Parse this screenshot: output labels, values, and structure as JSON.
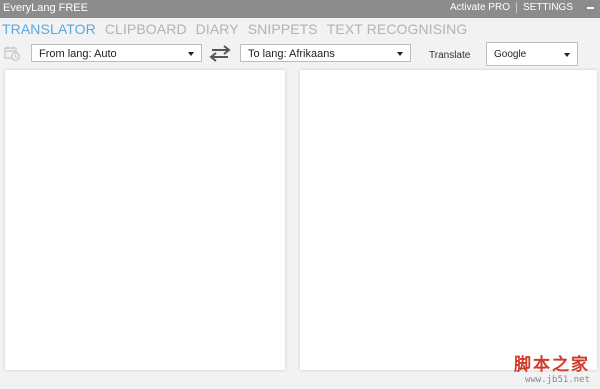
{
  "window": {
    "title": "EveryLang FREE",
    "activate_label": "Activate PRO",
    "settings_label": "SETTINGS"
  },
  "tabs": [
    {
      "label": "TRANSLATOR",
      "active": true
    },
    {
      "label": "CLIPBOARD",
      "active": false
    },
    {
      "label": "DIARY",
      "active": false
    },
    {
      "label": "SNIPPETS",
      "active": false
    },
    {
      "label": "TEXT RECOGNISING",
      "active": false
    }
  ],
  "toolbar": {
    "history_icon": "calendar-clock-icon",
    "from_lang": "From lang: Auto",
    "swap_icon": "swap-arrows-icon",
    "to_lang": "To lang: Afrikaans",
    "translate_label": "Translate",
    "service": "Google"
  },
  "panes": {
    "source_text": "",
    "translated_text": ""
  },
  "watermark": {
    "logo": "脚本之家",
    "url": "www.jb51.net"
  },
  "colors": {
    "titlebar": "#8c8c8c",
    "active_tab": "#5aa8de",
    "inactive_tab": "#b3b3b3",
    "background": "#f2f2f2"
  }
}
